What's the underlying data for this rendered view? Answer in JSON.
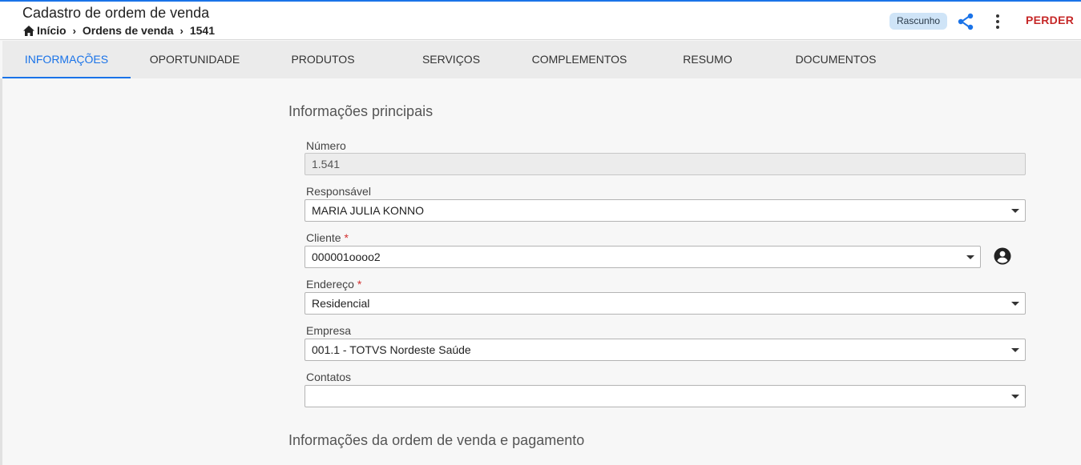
{
  "header": {
    "title": "Cadastro de ordem de venda",
    "breadcrumb": [
      {
        "label": "Início",
        "icon": "home-icon"
      },
      {
        "label": "Ordens de venda"
      },
      {
        "label": "1541"
      }
    ],
    "status_badge": "Rascunho",
    "share_icon": "share-icon",
    "more_icon": "more-vert-icon",
    "lose_button": "PERDER"
  },
  "tabs": [
    {
      "label": "INFORMAÇÕES",
      "active": true
    },
    {
      "label": "OPORTUNIDADE"
    },
    {
      "label": "PRODUTOS"
    },
    {
      "label": "SERVIÇOS"
    },
    {
      "label": "COMPLEMENTOS"
    },
    {
      "label": "RESUMO"
    },
    {
      "label": "DOCUMENTOS"
    }
  ],
  "section_main": {
    "title": "Informações principais",
    "fields": {
      "numero": {
        "label": "Número",
        "value": "1.541"
      },
      "responsavel": {
        "label": "Responsável",
        "value": "MARIA JULIA KONNO"
      },
      "cliente": {
        "label": "Cliente",
        "required_mark": "*",
        "value": "000001oooo2"
      },
      "endereco": {
        "label": "Endereço",
        "required_mark": "*",
        "value": "Residencial"
      },
      "empresa": {
        "label": "Empresa",
        "value": "001.1 - TOTVS Nordeste Saúde"
      },
      "contatos": {
        "label": "Contatos",
        "value": ""
      }
    }
  },
  "section_payment": {
    "title": "Informações da ordem de venda e pagamento"
  },
  "colors": {
    "accent": "#1a73e8",
    "danger": "#c62828",
    "badge_bg": "#cfe4f7"
  }
}
